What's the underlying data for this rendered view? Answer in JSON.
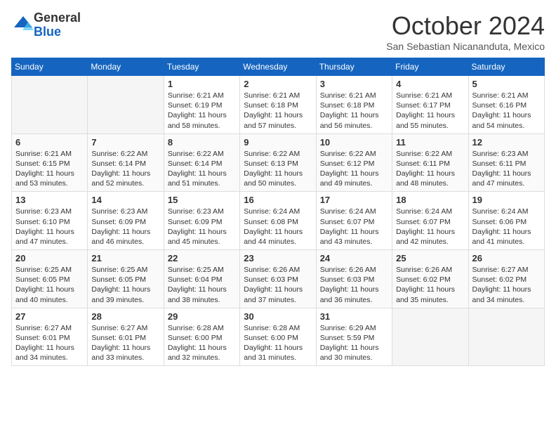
{
  "logo": {
    "general": "General",
    "blue": "Blue"
  },
  "title": "October 2024",
  "location": "San Sebastian Nicananduta, Mexico",
  "days_header": [
    "Sunday",
    "Monday",
    "Tuesday",
    "Wednesday",
    "Thursday",
    "Friday",
    "Saturday"
  ],
  "weeks": [
    [
      {
        "day": "",
        "empty": true
      },
      {
        "day": "",
        "empty": true
      },
      {
        "day": "1",
        "sunrise": "Sunrise: 6:21 AM",
        "sunset": "Sunset: 6:19 PM",
        "daylight": "Daylight: 11 hours and 58 minutes."
      },
      {
        "day": "2",
        "sunrise": "Sunrise: 6:21 AM",
        "sunset": "Sunset: 6:18 PM",
        "daylight": "Daylight: 11 hours and 57 minutes."
      },
      {
        "day": "3",
        "sunrise": "Sunrise: 6:21 AM",
        "sunset": "Sunset: 6:18 PM",
        "daylight": "Daylight: 11 hours and 56 minutes."
      },
      {
        "day": "4",
        "sunrise": "Sunrise: 6:21 AM",
        "sunset": "Sunset: 6:17 PM",
        "daylight": "Daylight: 11 hours and 55 minutes."
      },
      {
        "day": "5",
        "sunrise": "Sunrise: 6:21 AM",
        "sunset": "Sunset: 6:16 PM",
        "daylight": "Daylight: 11 hours and 54 minutes."
      }
    ],
    [
      {
        "day": "6",
        "sunrise": "Sunrise: 6:21 AM",
        "sunset": "Sunset: 6:15 PM",
        "daylight": "Daylight: 11 hours and 53 minutes."
      },
      {
        "day": "7",
        "sunrise": "Sunrise: 6:22 AM",
        "sunset": "Sunset: 6:14 PM",
        "daylight": "Daylight: 11 hours and 52 minutes."
      },
      {
        "day": "8",
        "sunrise": "Sunrise: 6:22 AM",
        "sunset": "Sunset: 6:14 PM",
        "daylight": "Daylight: 11 hours and 51 minutes."
      },
      {
        "day": "9",
        "sunrise": "Sunrise: 6:22 AM",
        "sunset": "Sunset: 6:13 PM",
        "daylight": "Daylight: 11 hours and 50 minutes."
      },
      {
        "day": "10",
        "sunrise": "Sunrise: 6:22 AM",
        "sunset": "Sunset: 6:12 PM",
        "daylight": "Daylight: 11 hours and 49 minutes."
      },
      {
        "day": "11",
        "sunrise": "Sunrise: 6:22 AM",
        "sunset": "Sunset: 6:11 PM",
        "daylight": "Daylight: 11 hours and 48 minutes."
      },
      {
        "day": "12",
        "sunrise": "Sunrise: 6:23 AM",
        "sunset": "Sunset: 6:11 PM",
        "daylight": "Daylight: 11 hours and 47 minutes."
      }
    ],
    [
      {
        "day": "13",
        "sunrise": "Sunrise: 6:23 AM",
        "sunset": "Sunset: 6:10 PM",
        "daylight": "Daylight: 11 hours and 47 minutes."
      },
      {
        "day": "14",
        "sunrise": "Sunrise: 6:23 AM",
        "sunset": "Sunset: 6:09 PM",
        "daylight": "Daylight: 11 hours and 46 minutes."
      },
      {
        "day": "15",
        "sunrise": "Sunrise: 6:23 AM",
        "sunset": "Sunset: 6:09 PM",
        "daylight": "Daylight: 11 hours and 45 minutes."
      },
      {
        "day": "16",
        "sunrise": "Sunrise: 6:24 AM",
        "sunset": "Sunset: 6:08 PM",
        "daylight": "Daylight: 11 hours and 44 minutes."
      },
      {
        "day": "17",
        "sunrise": "Sunrise: 6:24 AM",
        "sunset": "Sunset: 6:07 PM",
        "daylight": "Daylight: 11 hours and 43 minutes."
      },
      {
        "day": "18",
        "sunrise": "Sunrise: 6:24 AM",
        "sunset": "Sunset: 6:07 PM",
        "daylight": "Daylight: 11 hours and 42 minutes."
      },
      {
        "day": "19",
        "sunrise": "Sunrise: 6:24 AM",
        "sunset": "Sunset: 6:06 PM",
        "daylight": "Daylight: 11 hours and 41 minutes."
      }
    ],
    [
      {
        "day": "20",
        "sunrise": "Sunrise: 6:25 AM",
        "sunset": "Sunset: 6:05 PM",
        "daylight": "Daylight: 11 hours and 40 minutes."
      },
      {
        "day": "21",
        "sunrise": "Sunrise: 6:25 AM",
        "sunset": "Sunset: 6:05 PM",
        "daylight": "Daylight: 11 hours and 39 minutes."
      },
      {
        "day": "22",
        "sunrise": "Sunrise: 6:25 AM",
        "sunset": "Sunset: 6:04 PM",
        "daylight": "Daylight: 11 hours and 38 minutes."
      },
      {
        "day": "23",
        "sunrise": "Sunrise: 6:26 AM",
        "sunset": "Sunset: 6:03 PM",
        "daylight": "Daylight: 11 hours and 37 minutes."
      },
      {
        "day": "24",
        "sunrise": "Sunrise: 6:26 AM",
        "sunset": "Sunset: 6:03 PM",
        "daylight": "Daylight: 11 hours and 36 minutes."
      },
      {
        "day": "25",
        "sunrise": "Sunrise: 6:26 AM",
        "sunset": "Sunset: 6:02 PM",
        "daylight": "Daylight: 11 hours and 35 minutes."
      },
      {
        "day": "26",
        "sunrise": "Sunrise: 6:27 AM",
        "sunset": "Sunset: 6:02 PM",
        "daylight": "Daylight: 11 hours and 34 minutes."
      }
    ],
    [
      {
        "day": "27",
        "sunrise": "Sunrise: 6:27 AM",
        "sunset": "Sunset: 6:01 PM",
        "daylight": "Daylight: 11 hours and 34 minutes."
      },
      {
        "day": "28",
        "sunrise": "Sunrise: 6:27 AM",
        "sunset": "Sunset: 6:01 PM",
        "daylight": "Daylight: 11 hours and 33 minutes."
      },
      {
        "day": "29",
        "sunrise": "Sunrise: 6:28 AM",
        "sunset": "Sunset: 6:00 PM",
        "daylight": "Daylight: 11 hours and 32 minutes."
      },
      {
        "day": "30",
        "sunrise": "Sunrise: 6:28 AM",
        "sunset": "Sunset: 6:00 PM",
        "daylight": "Daylight: 11 hours and 31 minutes."
      },
      {
        "day": "31",
        "sunrise": "Sunrise: 6:29 AM",
        "sunset": "Sunset: 5:59 PM",
        "daylight": "Daylight: 11 hours and 30 minutes."
      },
      {
        "day": "",
        "empty": true
      },
      {
        "day": "",
        "empty": true
      }
    ]
  ]
}
